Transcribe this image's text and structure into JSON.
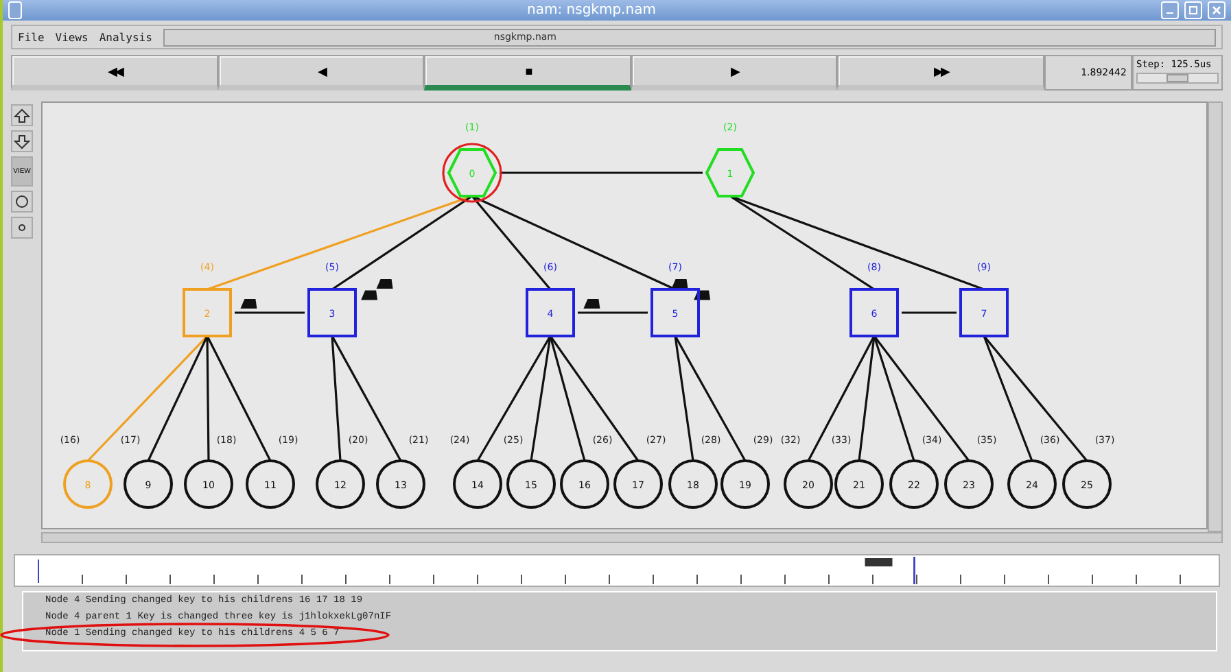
{
  "window": {
    "title": "nam: nsgkmp.nam"
  },
  "menu": [
    "File",
    "Views",
    "Analysis"
  ],
  "file_field": "nsgkmp.nam",
  "transport": [
    {
      "glyph": "◀◀",
      "selected": false
    },
    {
      "glyph": "◀",
      "selected": false
    },
    {
      "glyph": "■",
      "selected": true
    },
    {
      "glyph": "▶",
      "selected": false
    },
    {
      "glyph": "▶▶",
      "selected": false
    }
  ],
  "time": "1.892442",
  "step": {
    "label": "Step: 125.5us",
    "level": 0.5
  },
  "toolbar": [
    {
      "kind": "zoom-in"
    },
    {
      "kind": "zoom-out"
    },
    {
      "kind": "view",
      "label": "VIEW"
    },
    {
      "kind": "circle"
    },
    {
      "kind": "dot"
    }
  ],
  "network": {
    "nodes": [
      {
        "label": "0",
        "tag": "(1)",
        "kind": "hexagon",
        "color": "#22dd22",
        "marked": true,
        "peer_link": true,
        "children": [
          {
            "label": "2",
            "tag": "(4)",
            "kind": "square",
            "color": "#f0a020",
            "link_highlight": true,
            "packets": true,
            "peer_link": true,
            "children": [
              {
                "label": "8",
                "tag": "(16)",
                "kind": "circle",
                "color": "#f0a020",
                "link_highlight": true
              },
              {
                "label": "9",
                "tag": "(17)",
                "kind": "circle",
                "color": "#111111"
              },
              {
                "label": "10",
                "tag": "(18)",
                "kind": "circle",
                "color": "#111111"
              },
              {
                "label": "11",
                "tag": "(19)",
                "kind": "circle",
                "color": "#111111"
              }
            ]
          },
          {
            "label": "3",
            "tag": "(5)",
            "kind": "square",
            "color": "#2222dd",
            "packets": true,
            "children": [
              {
                "label": "12",
                "tag": "(20)",
                "kind": "circle",
                "color": "#111111"
              },
              {
                "label": "13",
                "tag": "(21)",
                "kind": "circle",
                "color": "#111111"
              }
            ]
          },
          {
            "label": "4",
            "tag": "(6)",
            "kind": "square",
            "color": "#2222dd",
            "packets": true,
            "peer_link": true,
            "children": [
              {
                "label": "14",
                "tag": "(24)",
                "kind": "circle",
                "color": "#111111"
              },
              {
                "label": "15",
                "tag": "(25)",
                "kind": "circle",
                "color": "#111111"
              },
              {
                "label": "16",
                "tag": "(26)",
                "kind": "circle",
                "color": "#111111"
              },
              {
                "label": "17",
                "tag": "(27)",
                "kind": "circle",
                "color": "#111111"
              }
            ]
          },
          {
            "label": "5",
            "tag": "(7)",
            "kind": "square",
            "color": "#2222dd",
            "packets": true,
            "children": [
              {
                "label": "18",
                "tag": "(28)",
                "kind": "circle",
                "color": "#111111"
              },
              {
                "label": "19",
                "tag": "(29)",
                "kind": "circle",
                "color": "#111111"
              }
            ]
          }
        ]
      },
      {
        "label": "1",
        "tag": "(2)",
        "kind": "hexagon",
        "color": "#22dd22",
        "children": [
          {
            "label": "6",
            "tag": "(8)",
            "kind": "square",
            "color": "#2222dd",
            "peer_link": true,
            "children": [
              {
                "label": "20",
                "tag": "(32)",
                "kind": "circle",
                "color": "#111111"
              },
              {
                "label": "21",
                "tag": "(33)",
                "kind": "circle",
                "color": "#111111"
              },
              {
                "label": "22",
                "tag": "(34)",
                "kind": "circle",
                "color": "#111111"
              },
              {
                "label": "23",
                "tag": "(35)",
                "kind": "circle",
                "color": "#111111"
              }
            ]
          },
          {
            "label": "7",
            "tag": "(9)",
            "kind": "square",
            "color": "#2222dd",
            "children": [
              {
                "label": "24",
                "tag": "(36)",
                "kind": "circle",
                "color": "#111111"
              },
              {
                "label": "25",
                "tag": "(37)",
                "kind": "circle",
                "color": "#111111"
              }
            ]
          }
        ]
      }
    ]
  },
  "timeline": {
    "level": 0.75
  },
  "log": {
    "lines": [
      {
        "text": "Node 4 Sending changed key to his childrens 16 17 18 19",
        "highlight": false
      },
      {
        "text": "Node 4 parent 1 Key is changed three key is j1hlokxekLg07nIF",
        "highlight": false
      },
      {
        "text": "Node 1 Sending changed key to his childrens 4 5 6 7",
        "highlight": true
      }
    ]
  }
}
